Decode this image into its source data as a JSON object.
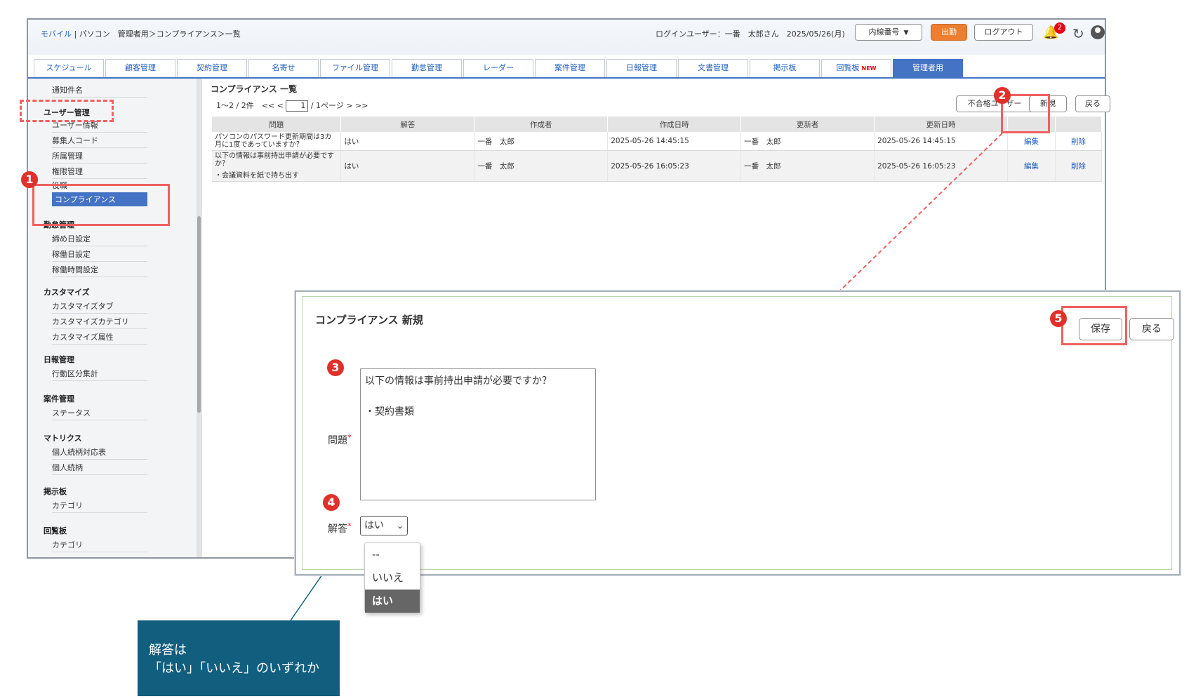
{
  "header": {
    "breadcrumb_mobile": "モバイル",
    "breadcrumb_rest": "| パソコン　管理者用＞コンプライアンス＞一覧",
    "login_text": "ログインユーザー：一番　太郎さん　2025/05/26(月)",
    "extension_select": "内線番号",
    "clock_in_label": "出勤",
    "logout_label": "ログアウト",
    "notification_count": "2"
  },
  "tabs": [
    {
      "label": "スケジュール"
    },
    {
      "label": "顧客管理"
    },
    {
      "label": "契約管理"
    },
    {
      "label": "名寄せ"
    },
    {
      "label": "ファイル管理"
    },
    {
      "label": "勤怠管理"
    },
    {
      "label": "レーダー"
    },
    {
      "label": "案件管理"
    },
    {
      "label": "日報管理"
    },
    {
      "label": "文書管理"
    },
    {
      "label": "掲示板"
    },
    {
      "label": "回覧板",
      "badge": "NEW"
    },
    {
      "label": "管理者用",
      "active": true
    }
  ],
  "sidebar": {
    "notification_item": "通知件名",
    "user_mgmt": "ユーザー管理",
    "user_items": [
      "ユーザー情報",
      "募集人コード",
      "所属管理",
      "権限管理",
      "役職",
      "コンプライアンス"
    ],
    "attendance": "勤怠管理",
    "attendance_items": [
      "締め日設定",
      "稼働日設定",
      "稼働時間設定"
    ],
    "customize": "カスタマイズ",
    "customize_items": [
      "カスタマイズタブ",
      "カスタマイズカテゴリ",
      "カスタマイズ属性"
    ],
    "daily": "日報管理",
    "daily_items": [
      "行動区分集計"
    ],
    "project": "案件管理",
    "project_items": [
      "ステータス"
    ],
    "matrix": "マトリクス",
    "matrix_items": [
      "個人続柄対応表",
      "個人続柄"
    ],
    "board": "掲示板",
    "board_items": [
      "カテゴリ"
    ],
    "circular": "回覧板",
    "circular_items": [
      "カテゴリ"
    ]
  },
  "list": {
    "title": "コンプライアンス 一覧",
    "pager_prefix": "1～2 / 2件　<< <",
    "page_value": "1",
    "pager_suffix": "/ 1ページ > >>",
    "fail_users_button": "不合格ユーザー",
    "new_button": "新規",
    "back_button": "戻る",
    "columns": [
      "問題",
      "解答",
      "作成者",
      "作成日時",
      "更新者",
      "更新日時",
      "",
      ""
    ],
    "rows": [
      {
        "question": "パソコンのパスワード更新期間は3カ月に1度であっていますか？",
        "answer": "はい",
        "creator": "一番　太郎",
        "created": "2025-05-26 14:45:15",
        "updater": "一番　太郎",
        "updated": "2025-05-26 14:45:15",
        "edit": "編集",
        "delete": "削除"
      },
      {
        "question_l1": "以下の情報は事前持出申請が必要ですか？",
        "question_l2": "・会議資料を紙で持ち出す",
        "answer": "はい",
        "creator": "一番　太郎",
        "created": "2025-05-26 16:05:23",
        "updater": "一番　太郎",
        "updated": "2025-05-26 16:05:23",
        "edit": "編集",
        "delete": "削除"
      }
    ]
  },
  "dialog": {
    "title": "コンプライアンス 新規",
    "save_button": "保存",
    "back_button": "戻る",
    "question_label": "問題",
    "required_mark": "*",
    "question_value": "以下の情報は事前持出申請が必要ですか？\n\n・契約書類",
    "answer_label": "解答",
    "answer_selected": "はい",
    "options": [
      "--",
      "いいえ",
      "はい"
    ]
  },
  "annotations": {
    "steps": [
      "1",
      "2",
      "3",
      "4",
      "5"
    ],
    "callout_line1": "解答は",
    "callout_line2": "「はい」「いいえ」のいずれか",
    "color": "#e0302a"
  }
}
